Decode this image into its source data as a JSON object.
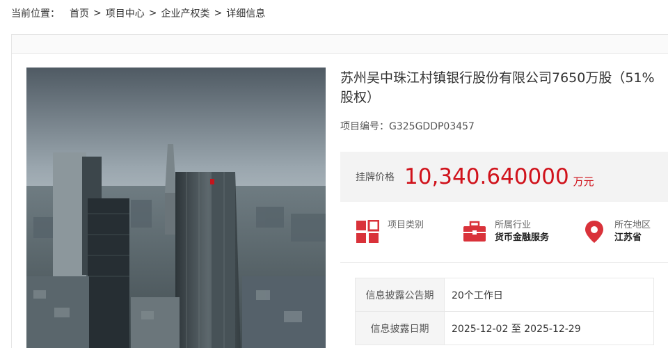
{
  "breadcrumb": {
    "label": "当前位置：",
    "items": [
      "首页",
      "项目中心",
      "企业产权类",
      "详细信息"
    ],
    "separator": ">"
  },
  "project": {
    "title": "苏州吴中珠江村镇银行股份有限公司7650万股（51%股权）",
    "code_label": "项目编号：",
    "code": "G325GDDP03457"
  },
  "price": {
    "label": "挂牌价格",
    "value": "10,340.640000",
    "unit": "万元",
    "color": "#d0121b"
  },
  "meta": [
    {
      "icon": "category-icon",
      "key": "项目类别",
      "value": ""
    },
    {
      "icon": "briefcase-icon",
      "key": "所属行业",
      "value": "货币金融服务"
    },
    {
      "icon": "location-pin-icon",
      "key": "所在地区",
      "value": "江苏省"
    }
  ],
  "info_rows": [
    {
      "key": "信息披露公告期",
      "value": "20个工作日"
    },
    {
      "key": "信息披露日期",
      "value": "2025-12-02 至 2025-12-29"
    }
  ]
}
